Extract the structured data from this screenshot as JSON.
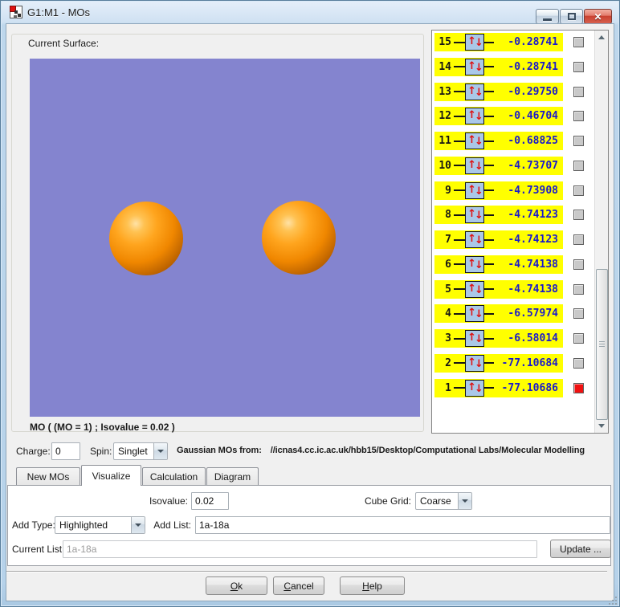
{
  "window": {
    "title": "G1:M1 - MOs"
  },
  "icons": {
    "app": "molecule-document",
    "minimize": "minimize-dash",
    "maximize": "maximize-box",
    "close": "✕",
    "dropdown": "▼",
    "scroll_up": "▲",
    "scroll_down": "▼",
    "spin_up": "↑",
    "spin_down": "↓"
  },
  "surface_panel": {
    "label": "Current Surface:",
    "caption": "MO ( (MO = 1) ; Isovalue = 0.02 )"
  },
  "mo_list": {
    "rows": [
      {
        "index": 15,
        "energy": "-0.28741",
        "selected": false
      },
      {
        "index": 14,
        "energy": "-0.28741",
        "selected": false
      },
      {
        "index": 13,
        "energy": "-0.29750",
        "selected": false
      },
      {
        "index": 12,
        "energy": "-0.46704",
        "selected": false
      },
      {
        "index": 11,
        "energy": "-0.68825",
        "selected": false
      },
      {
        "index": 10,
        "energy": "-4.73707",
        "selected": false
      },
      {
        "index": 9,
        "energy": "-4.73908",
        "selected": false
      },
      {
        "index": 8,
        "energy": "-4.74123",
        "selected": false
      },
      {
        "index": 7,
        "energy": "-4.74123",
        "selected": false
      },
      {
        "index": 6,
        "energy": "-4.74138",
        "selected": false
      },
      {
        "index": 5,
        "energy": "-4.74138",
        "selected": false
      },
      {
        "index": 4,
        "energy": "-6.57974",
        "selected": false
      },
      {
        "index": 3,
        "energy": "-6.58014",
        "selected": false
      },
      {
        "index": 2,
        "energy": "-77.10684",
        "selected": false
      },
      {
        "index": 1,
        "energy": "-77.10686",
        "selected": true
      }
    ]
  },
  "controls": {
    "charge_label": "Charge:",
    "charge_value": "0",
    "spin_label": "Spin:",
    "spin_value": "Singlet",
    "source_label": "Gaussian MOs from:",
    "source_path": "//icnas4.cc.ic.ac.uk/hbb15/Desktop/Computational Labs/Molecular Modelling"
  },
  "tabs": [
    {
      "label": "New MOs"
    },
    {
      "label": "Visualize"
    },
    {
      "label": "Calculation"
    },
    {
      "label": "Diagram"
    }
  ],
  "visualize_tab": {
    "isovalue_label": "Isovalue:",
    "isovalue_value": "0.02",
    "cube_grid_label": "Cube Grid:",
    "cube_grid_value": "Coarse",
    "add_type_label": "Add Type:",
    "add_type_value": "Highlighted",
    "add_list_label": "Add List:",
    "add_list_value": "1a-18a",
    "current_list_label": "Current List:",
    "current_list_value": "1a-18a",
    "update_label": "Update ..."
  },
  "footer": {
    "ok_label": "Ok",
    "cancel_label": "Cancel",
    "help_label": "Help"
  },
  "colors": {
    "level_highlight": "#ffff00",
    "energy_text": "#1a1acc",
    "viewport_background": "#8484cf",
    "sphere": "#f08700",
    "spin_box": "#aac8e8",
    "selected_checkbox": "#f01111"
  }
}
